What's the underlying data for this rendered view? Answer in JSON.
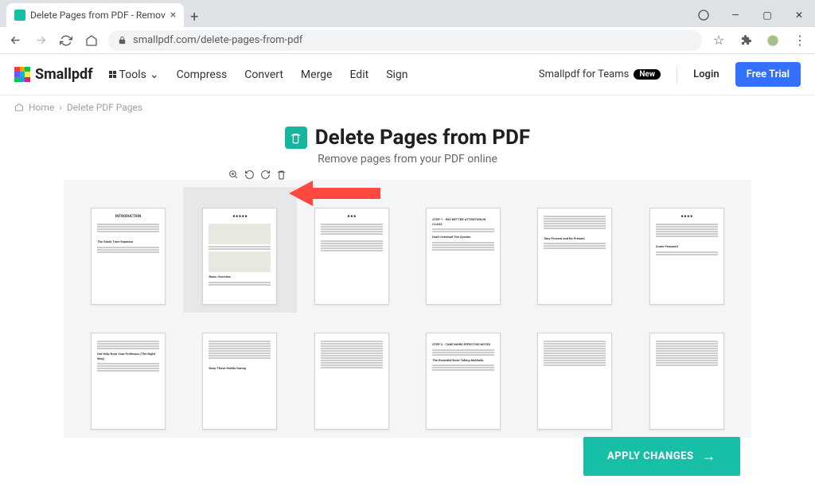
{
  "browser": {
    "tab_title": "Delete Pages from PDF - Remov",
    "url": "smallpdf.com/delete-pages-from-pdf",
    "buttons": {
      "new_tab": "+",
      "minimize": "—",
      "maximize": "▢",
      "close": "✕"
    }
  },
  "header": {
    "logo_text": "Smallpdf",
    "menu": {
      "tools": "Tools",
      "compress": "Compress",
      "convert": "Convert",
      "merge": "Merge",
      "edit": "Edit",
      "sign": "Sign"
    },
    "teams_link": "Smallpdf for Teams",
    "teams_badge": "New",
    "login": "Login",
    "trial": "Free Trial"
  },
  "breadcrumb": {
    "home": "Home",
    "current": "Delete PDF Pages"
  },
  "title": {
    "heading": "Delete Pages from PDF",
    "subtitle": "Remove pages from your PDF online"
  },
  "tools": {
    "zoom": "zoom-in-icon",
    "rotate_left": "rotate-left-icon",
    "rotate_right": "rotate-right-icon",
    "delete": "trash-icon"
  },
  "apply_button": "APPLY CHANGES",
  "colors": {
    "accent": "#18bfa7",
    "primary_btn": "#3370ff",
    "arrow": "#ff4940"
  }
}
